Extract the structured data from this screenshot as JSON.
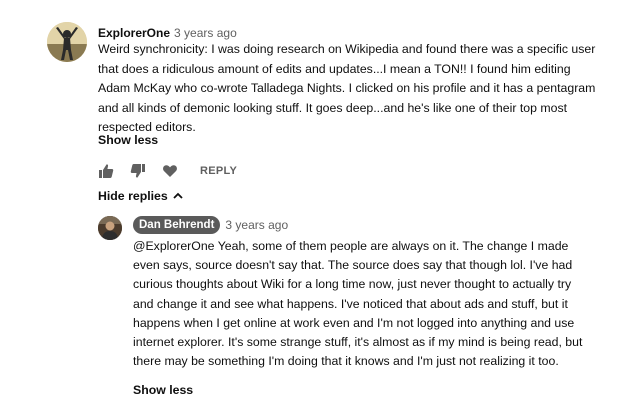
{
  "comment": {
    "author": "ExplorerOne",
    "time": "3 years ago",
    "text": "Weird synchronicity: I was doing research on Wikipedia and found there was a specific user that does a ridiculous amount of edits and updates...I mean a TON!! I found him editing Adam McKay who co-wrote Talladega Nights. I clicked on his profile and it has a pentagram and all kinds of demonic looking stuff. It goes deep...and he's like one of their top most respected editors.",
    "show_less": "Show less",
    "like_icon": "thumb-up-icon",
    "dislike_icon": "thumb-down-icon",
    "heart_icon": "heart-icon",
    "reply_label": "REPLY",
    "hide_replies": "Hide replies"
  },
  "reply": {
    "author": "Dan Behrendt",
    "time": "3 years ago",
    "text": "@ExplorerOne Yeah, some of them people are always on it. The change I made even says, source doesn't say that. The source does say that though lol. I've had curious thoughts about Wiki for a long time now, just never thought to actually try and change it and see what happens. I've noticed that about ads and stuff, but it happens when I get online at work even and I'm not logged into anything and use internet explorer. It's some strange stuff, it's almost as if my mind is being read, but there may be something I'm doing that it knows and I'm just not realizing it too.",
    "show_less": "Show less"
  },
  "colors": {
    "text": "#0f0f0f",
    "secondary": "#606060",
    "author_chip": "#5a5a5a"
  }
}
